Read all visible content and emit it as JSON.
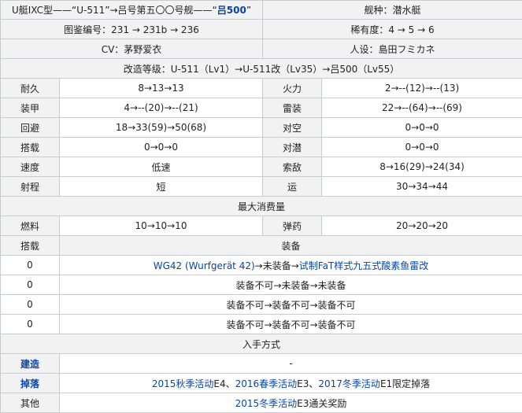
{
  "header": {
    "name_prefix": "U艇IXC型——“U-511”→吕号第五〇〇号舰——“",
    "name_link": "吕500",
    "name_suffix": "”",
    "ship_type": "舰种：潜水艇",
    "catalog_no": "图鉴编号：231 → 231b → 236",
    "rarity": "稀有度：4 → 5 → 6",
    "cv": "CV：茅野爱衣",
    "illustrator": "人设：島田フミカネ",
    "remodel": "改造等级：U-511（Lv1）→U-511改（Lv35）→吕500（Lv55）"
  },
  "stats": [
    {
      "l_label": "耐久",
      "l_value": "8→13→13",
      "r_label": "火力",
      "r_value": "2→--(12)→--(13)"
    },
    {
      "l_label": "装甲",
      "l_value": "4→--(20)→--(21)",
      "r_label": "雷装",
      "r_value": "22→--(64)→--(69)"
    },
    {
      "l_label": "回避",
      "l_value": "18→33(59)→50(68)",
      "r_label": "对空",
      "r_value": "0→0→0"
    },
    {
      "l_label": "搭载",
      "l_value": "0→0→0",
      "r_label": "对潜",
      "r_value": "0→0→0"
    },
    {
      "l_label": "速度",
      "l_value": "低速",
      "r_label": "索敌",
      "r_value": "8→16(29)→24(34)"
    },
    {
      "l_label": "射程",
      "l_value": "短",
      "r_label": "运",
      "r_value": "30→34→44"
    }
  ],
  "consumption": {
    "title": "最大消费量",
    "fuel_label": "燃料",
    "fuel_value": "10→10→10",
    "ammo_label": "弹药",
    "ammo_value": "20→20→20"
  },
  "equipment": {
    "slot_header": "搭载",
    "equip_header": "装备",
    "rows": [
      {
        "slot": "0",
        "link1": "WG42 (Wurfgerät 42)",
        "middle": "→未装备→",
        "link2": "试制FaT样式九五式酸素鱼雷改",
        "plain": ""
      },
      {
        "slot": "0",
        "link1": "",
        "middle": "",
        "link2": "",
        "plain": "装备不可→未装备→未装备"
      },
      {
        "slot": "0",
        "link1": "",
        "middle": "",
        "link2": "",
        "plain": "装备不可→装备不可→装备不可"
      },
      {
        "slot": "0",
        "link1": "",
        "middle": "",
        "link2": "",
        "plain": "装备不可→装备不可→装备不可"
      }
    ]
  },
  "acquisition": {
    "title": "入手方式",
    "build_label": "建造",
    "build_value": "-",
    "drop_label": "掉落",
    "drop_link1": "2015秋季活动",
    "drop_text1": "E4、",
    "drop_link2": "2016春季活动",
    "drop_text2": "E3、",
    "drop_link3": "2017冬季活动",
    "drop_text3": "E1限定掉落",
    "other_label": "其他",
    "other_link": "2015冬季活动",
    "other_text": "E3通关奖励"
  }
}
